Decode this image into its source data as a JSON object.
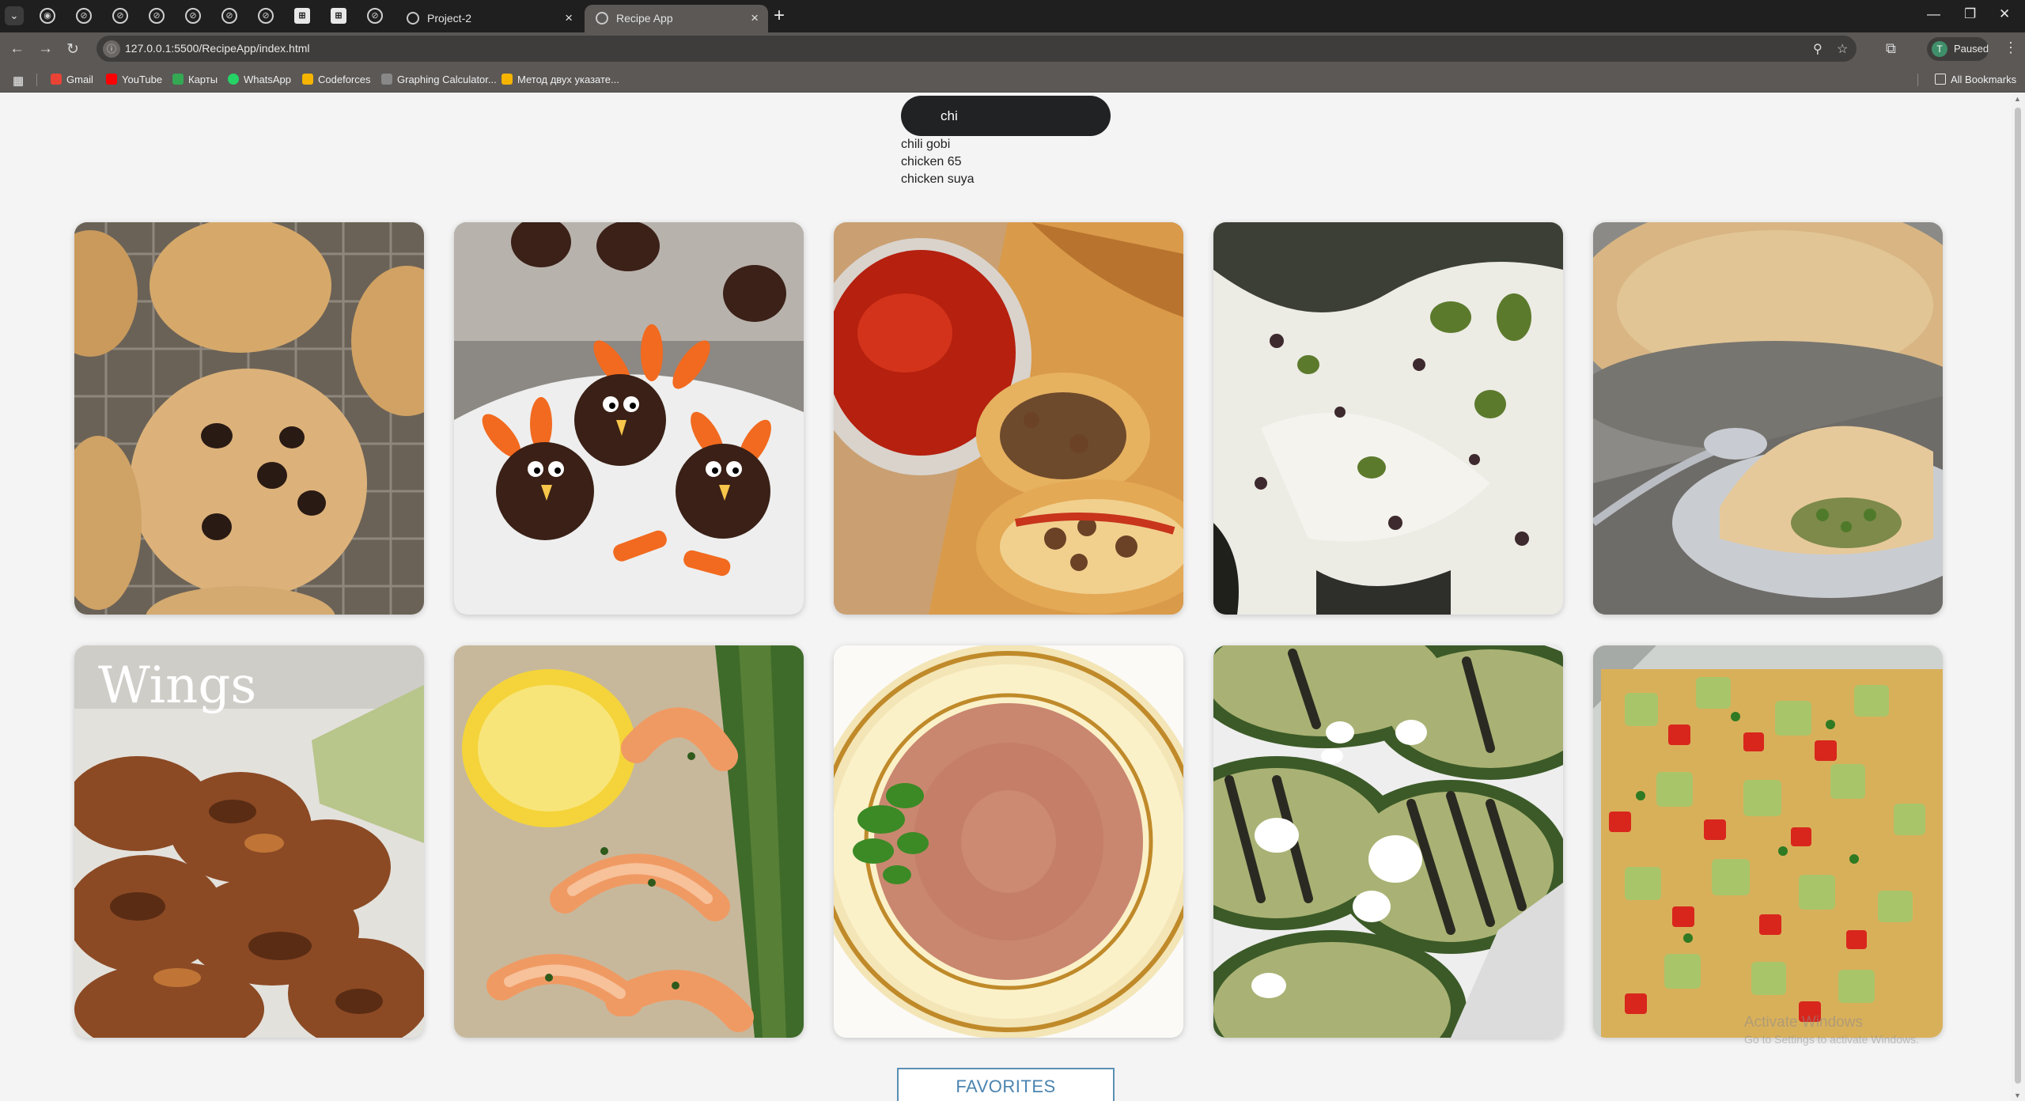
{
  "browser": {
    "tabs": [
      {
        "title": "Project-2",
        "active": false
      },
      {
        "title": "Recipe App",
        "active": true
      }
    ],
    "url": "127.0.0.1:5500/RecipeApp/index.html",
    "profile_status": "Paused",
    "profile_initial": "T",
    "bookmarks": [
      {
        "label": "Gmail",
        "color": "#ea4335"
      },
      {
        "label": "YouTube",
        "color": "#ff0000"
      },
      {
        "label": "Карты",
        "color": "#34a853"
      },
      {
        "label": "WhatsApp",
        "color": "#25d366"
      },
      {
        "label": "Codeforces",
        "color": "#f4b400"
      },
      {
        "label": "Graphing Calculator...",
        "color": "#888888"
      },
      {
        "label": "Метод двух указате...",
        "color": "#f4b400"
      }
    ],
    "all_bookmarks": "All Bookmarks"
  },
  "search": {
    "value": "chi",
    "suggestions": [
      "chili gobi",
      "chicken 65",
      "chicken suya"
    ]
  },
  "meals": [
    {
      "name": "oat-chocolate-chip-cookies",
      "photo": "cookies"
    },
    {
      "name": "chocolate-turkey-truffles",
      "photo": "turkey-truffles"
    },
    {
      "name": "pizza-stromboli-with-sauce",
      "photo": "stromboli"
    },
    {
      "name": "pistachio-cranberry-ice-cream",
      "photo": "ice-cream"
    },
    {
      "name": "vegetable-pot-pie",
      "photo": "pot-pie"
    },
    {
      "name": "chicken-wings",
      "photo": "wings",
      "overlay_text": "Wings"
    },
    {
      "name": "lemon-garlic-shrimp",
      "photo": "shrimp"
    },
    {
      "name": "refried-beans",
      "photo": "beans"
    },
    {
      "name": "grilled-zucchini-feta",
      "photo": "zucchini"
    },
    {
      "name": "avocado-tomato-salad",
      "photo": "salad"
    }
  ],
  "favorites_label": "FAVORITES",
  "watermark": {
    "title": "Activate Windows",
    "subtitle": "Go to Settings to activate Windows."
  }
}
